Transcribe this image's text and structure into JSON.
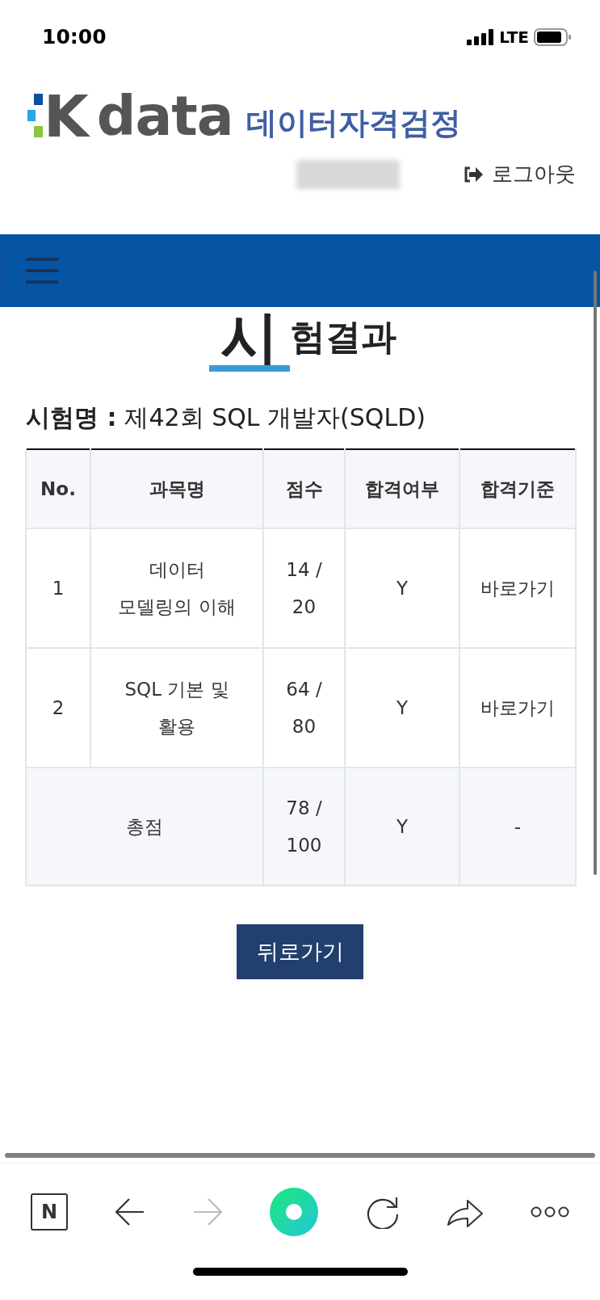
{
  "status_bar": {
    "time": "10:00",
    "network": "LTE"
  },
  "header": {
    "logo": {
      "mark": "K",
      "word": "data",
      "subtitle": "데이터자격검정"
    },
    "logout": "로그아웃"
  },
  "page_title": {
    "initial": "시",
    "rest": "험결과"
  },
  "exam": {
    "label": "시험명 :",
    "value": "제42회 SQL 개발자(SQLD)"
  },
  "table": {
    "columns": [
      "No.",
      "과목명",
      "점수",
      "합격여부",
      "합격기준"
    ],
    "rows": [
      {
        "kind": "subject",
        "no": "1",
        "subject": "데이터 모델링의 이해",
        "score": "14 / 20",
        "passed": "Y",
        "criteria": "바로가기"
      },
      {
        "kind": "subject",
        "no": "2",
        "subject": "SQL 기본 및 활용",
        "score": "64 / 80",
        "passed": "Y",
        "criteria": "바로가기"
      },
      {
        "kind": "total",
        "subject": "총점",
        "score": "78 / 100",
        "passed": "Y",
        "criteria": "-"
      }
    ]
  },
  "back_button": "뒤로가기",
  "toolbar": [
    {
      "kind": "naver",
      "label": "N"
    },
    {
      "kind": "back",
      "disabled": false
    },
    {
      "kind": "forward",
      "disabled": true
    },
    {
      "kind": "home"
    },
    {
      "kind": "reload"
    },
    {
      "kind": "share"
    },
    {
      "kind": "more"
    }
  ]
}
